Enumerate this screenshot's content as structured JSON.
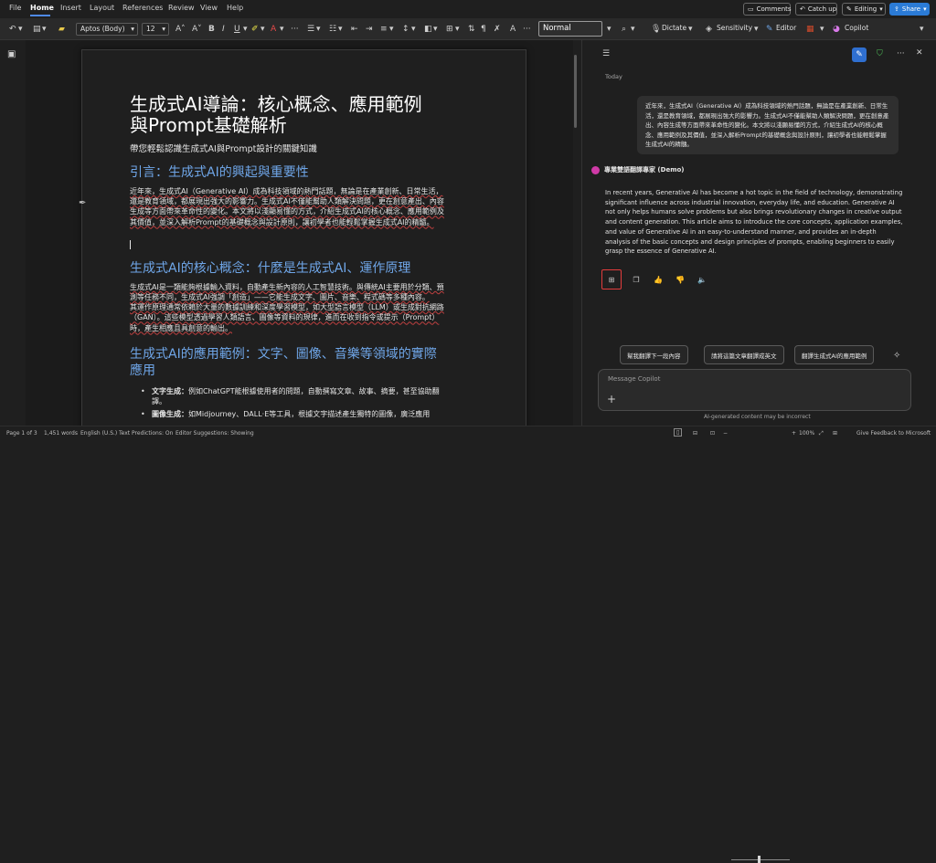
{
  "menu": {
    "file": "File",
    "home": "Home",
    "insert": "Insert",
    "layout": "Layout",
    "references": "References",
    "review": "Review",
    "view": "View",
    "help": "Help"
  },
  "top_buttons": {
    "comments": "Comments",
    "catchup": "Catch up",
    "editing": "Editing",
    "share": "Share"
  },
  "toolbar": {
    "font": "Aptos (Body)",
    "size": "12",
    "style": "Normal",
    "dictate": "Dictate",
    "sensitivity": "Sensitivity",
    "editor": "Editor",
    "copilot": "Copilot"
  },
  "doc": {
    "title1": "生成式AI導論：核心概念、應用範例",
    "title2": "與Prompt基礎解析",
    "subtitle": "帶您輕鬆認識生成式AI與Prompt設計的關鍵知識",
    "h_intro": "引言：生成式AI的興起與重要性",
    "p_intro": "近年來，生成式AI（Generative AI）成為科技領域的熱門話題，無論是在產業創新、日常生活，還是教育領域，都展現出強大的影響力。生成式AI不僅能幫助人類解決問題，更在創意產出、內容生成等方面帶來革命性的變化。本文將以淺顯易懂的方式，介紹生成式AI的核心概念、應用範例及其價值，並深入解析Prompt的基礎概念與設計原則，讓初學者也能輕鬆掌握生成式AI的精髓。",
    "h_core": "生成式AI的核心概念：什麼是生成式AI、運作原理",
    "p_core1": "生成式AI是一類能夠根據輸入資料，自動產生新內容的人工智慧技術。與傳統AI主要用於分類、預測等任務不同，生成式AI強調「創造」——它能生成文字、圖片、音樂、程式碼等多種內容。",
    "p_core2": "其運作原理通常依賴於大量的數據訓練和深度學習模型，如大型語言模型（LLM）或生成對抗網路（GAN）。這些模型透過學習人類語言、圖像等資料的規律，進而在收到指令或提示（Prompt）時，產生相應且具創意的輸出。",
    "h_app": "生成式AI的應用範例：文字、圖像、音樂等領域的實際應用",
    "b1_label": "文字生成：",
    "b1_text": "例如ChatGPT能根據使用者的問題，自動撰寫文章、故事、摘要，甚至協助翻譯。",
    "b2_label": "圖像生成：",
    "b2_text": "如Midjourney、DALL·E等工具，根據文字描述產生獨特的圖像，廣泛應用"
  },
  "copilot": {
    "today": "Today",
    "user_msg": "近年來，生成式AI（Generative AI）成為科技領域的熱門話題，無論是在產業創新、日常生活，還是教育領域，都展現出強大的影響力。生成式AI不僅能幫助人類解決問題，更在創意產出、內容生成等方面帶來革命性的變化。本文將以淺顯易懂的方式，介紹生成式AI的核心概念、應用範例及其價值，並深入解析Prompt的基礎概念與設計原則，讓初學者也能輕鬆掌握生成式AI的精髓。",
    "agent_name": "專業雙語翻譯專家 (Demo)",
    "reply": "In recent years, Generative AI has become a hot topic in the field of technology, demonstrating significant influence across industrial innovation, everyday life, and education. Generative AI not only helps humans solve problems but also brings revolutionary changes in creative output and content generation. This article aims to introduce the core concepts, application examples, and value of Generative AI in an easy-to-understand manner, and provides an in-depth analysis of the basic concepts and design principles of prompts, enabling beginners to easily grasp the essence of Generative AI.",
    "chip1": "幫我翻譯下一段內容",
    "chip2": "請將這篇文章翻譯成英文",
    "chip3": "翻譯生成式AI的應用範例",
    "placeholder": "Message Copilot",
    "disclaimer": "AI-generated content may be incorrect"
  },
  "status": {
    "page": "Page 1 of 3",
    "words": "1,451 words",
    "lang": "English (U.S.)",
    "predictions": "Text Predictions: On",
    "suggestions": "Editor Suggestions: Showing",
    "zoom": "100%",
    "feedback": "Give Feedback to Microsoft"
  }
}
